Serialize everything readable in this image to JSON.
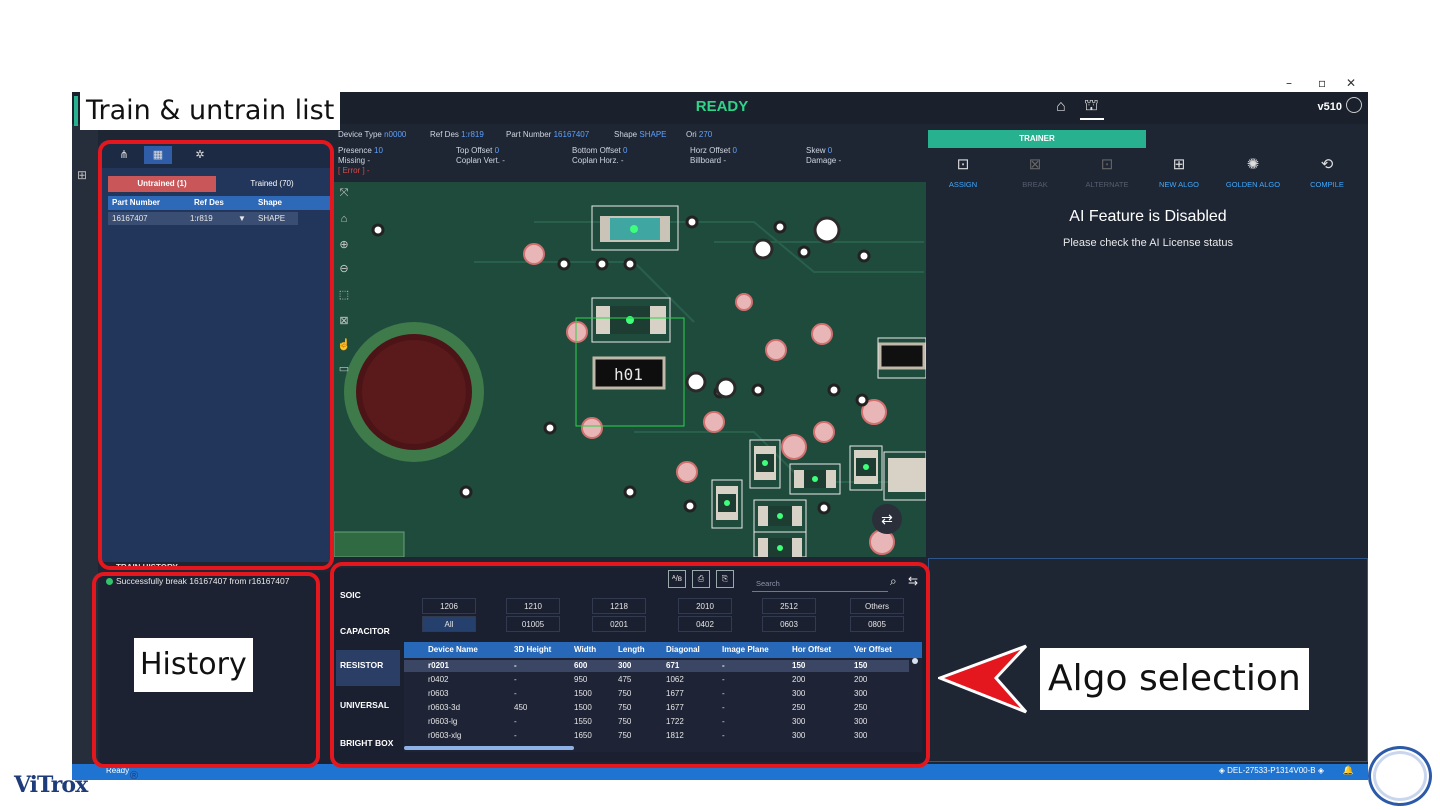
{
  "window": {
    "minimize": "–",
    "maximize": "▫",
    "close": "✕"
  },
  "header": {
    "status": "READY",
    "version": "v510"
  },
  "annotations": {
    "train_list": "Train & untrain list",
    "history": "History",
    "algo": "Algo selection"
  },
  "left_panel": {
    "untrained_tab": "Untrained (1)",
    "trained_tab": "Trained (70)",
    "columns": [
      "Part Number",
      "Ref Des",
      "Shape"
    ],
    "rows": [
      {
        "part": "16167407",
        "ref": "1:r819",
        "shape": "SHAPE"
      }
    ]
  },
  "history": {
    "title": "TRAIN HISTORY",
    "entries": [
      "Successfully break 16167407 from r16167407"
    ]
  },
  "info": {
    "device_type_label": "Device Type",
    "device_type": "n0000",
    "ref_des_label": "Ref Des",
    "ref_des": "1:r819",
    "part_number_label": "Part Number",
    "part_number": "16167407",
    "shape_label": "Shape",
    "shape": "SHAPE",
    "ori_label": "Ori",
    "ori": "270",
    "presence_label": "Presence",
    "presence": "10",
    "missing_label": "Missing",
    "missing": "-",
    "error_label": "[ Error ]",
    "error": "-",
    "top_offset_label": "Top Offset",
    "top_offset": "0",
    "coplan_vert_label": "Coplan Vert.",
    "coplan_vert": "-",
    "bottom_offset_label": "Bottom Offset",
    "bottom_offset": "0",
    "coplan_horz_label": "Coplan Horz.",
    "coplan_horz": "-",
    "horz_offset_label": "Horz Offset",
    "horz_offset": "0",
    "billboard_label": "Billboard",
    "billboard": "-",
    "skew_label": "Skew",
    "skew": "0",
    "damage_label": "Damage",
    "damage": "-"
  },
  "trainer": {
    "header": "TRAINER",
    "buttons": [
      "ASSIGN",
      "BREAK",
      "ALTERNATE",
      "NEW ALGO",
      "GOLDEN ALGO",
      "COMPILE"
    ],
    "ai_title": "AI Feature is Disabled",
    "ai_sub": "Please check the AI License status"
  },
  "algo": {
    "categories": [
      "SOIC",
      "CAPACITOR",
      "RESISTOR",
      "UNIVERSAL",
      "BRIGHT BOX"
    ],
    "search_placeholder": "Search",
    "tool_labels": [
      "ᴬ/ʙ",
      "⎙",
      "⎘"
    ],
    "sizes_row1": [
      "1206",
      "1210",
      "1218",
      "2010",
      "2512",
      "Others"
    ],
    "sizes_row2": [
      "All",
      "01005",
      "0201",
      "0402",
      "0603",
      "0805"
    ],
    "table_columns": [
      "Device Name",
      "3D Height",
      "Width",
      "Length",
      "Diagonal",
      "Image Plane",
      "Hor Offset",
      "Ver Offset"
    ],
    "table_rows": [
      [
        "r0201",
        "-",
        "600",
        "300",
        "671",
        "-",
        "150",
        "150"
      ],
      [
        "r0402",
        "-",
        "950",
        "475",
        "1062",
        "-",
        "200",
        "200"
      ],
      [
        "r0603",
        "-",
        "1500",
        "750",
        "1677",
        "-",
        "300",
        "300"
      ],
      [
        "r0603-3d",
        "450",
        "1500",
        "750",
        "1677",
        "-",
        "250",
        "250"
      ],
      [
        "r0603-lg",
        "-",
        "1550",
        "750",
        "1722",
        "-",
        "300",
        "300"
      ],
      [
        "r0603-xlg",
        "-",
        "1650",
        "750",
        "1812",
        "-",
        "300",
        "300"
      ]
    ]
  },
  "status": {
    "left": "Ready",
    "right": "DEL-27533-P1314V00-B"
  },
  "logo": {
    "text": "ViTrox",
    "mark": "®"
  },
  "colors": {
    "accent": "#27b18f",
    "ready": "#2fd48a",
    "annotation": "#e4171e",
    "status_bar": "#1e74d0"
  }
}
